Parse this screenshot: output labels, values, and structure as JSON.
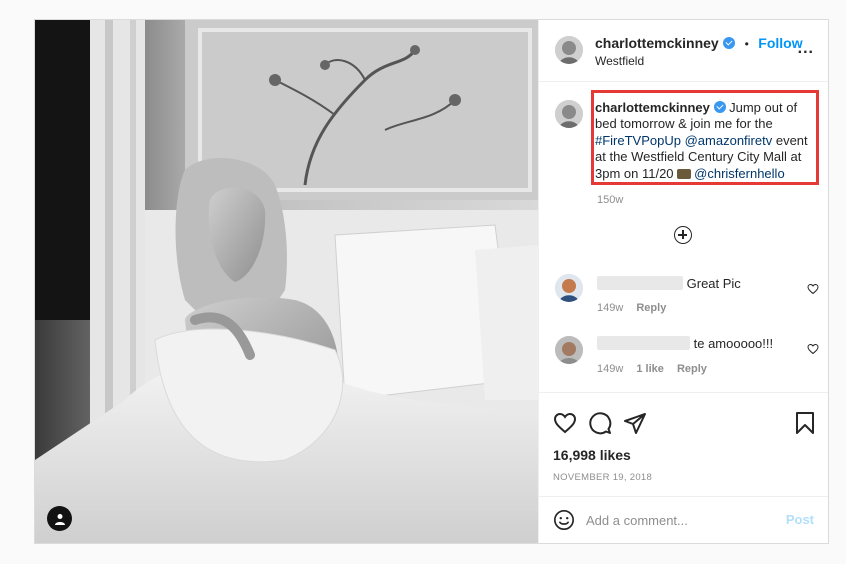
{
  "header": {
    "username": "charlottemckinney",
    "separator": "•",
    "follow_label": "Follow",
    "location": "Westfield",
    "more_label": "..."
  },
  "caption": {
    "username": "charlottemckinney",
    "text_1": "Jump out of bed tomorrow & join me for the ",
    "hashtag": "#FireTVPopUp",
    "mention_1": "@amazonfiretv",
    "text_2": " event at the Westfield Century City Mall at 3pm on 11/20 ",
    "mention_2": "@chrisfernhello",
    "time": "150w"
  },
  "comments": [
    {
      "text": "Great Pic",
      "time": "149w",
      "reply_label": "Reply"
    },
    {
      "text": "te amooooo!!!",
      "time": "149w",
      "likes": "1 like",
      "reply_label": "Reply"
    }
  ],
  "post": {
    "likes": "16,998 likes",
    "date": "NOVEMBER 19, 2018"
  },
  "add_comment": {
    "placeholder": "Add a comment...",
    "post_label": "Post"
  },
  "colors": {
    "accent": "#0095f6",
    "highlight_border": "#e53935",
    "verified": "#3897f0"
  }
}
